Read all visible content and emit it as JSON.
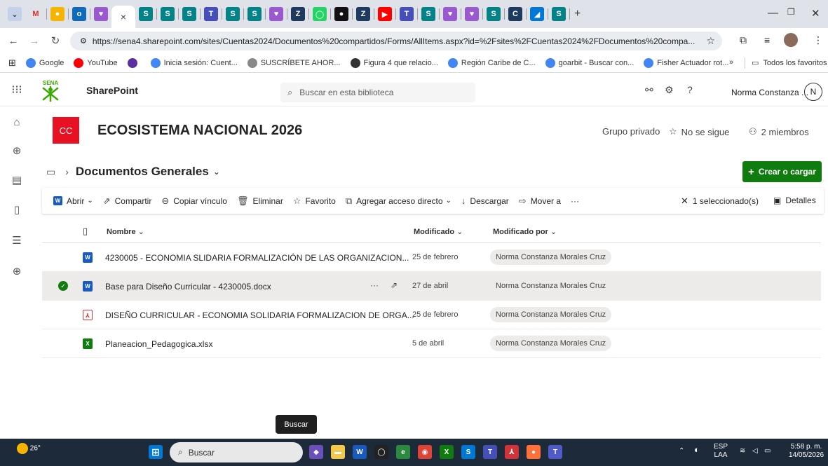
{
  "browser": {
    "url": "https://sena4.sharepoint.com/sites/Cuentas2024/Documentos%20compartidos/Forms/AllItems.aspx?id=%2Fsites%2FCuentas2024%2FDocumentos%20compa...",
    "active_tab_close": "×",
    "new_tab": "+",
    "bookmarks": [
      {
        "label": "Google",
        "color": "#4285f4"
      },
      {
        "label": "YouTube",
        "color": "#ff0000"
      },
      {
        "label": "",
        "color": "#5b2fa0"
      },
      {
        "label": "Inicia sesión: Cuent...",
        "color": "#4285f4"
      },
      {
        "label": "SUSCRÍBETE AHOR...",
        "color": "#888888"
      },
      {
        "label": "Figura 4 que relacio...",
        "color": "#333333"
      },
      {
        "label": "Región Caribe de C...",
        "color": "#4285f4"
      },
      {
        "label": "goarbit - Buscar con...",
        "color": "#4285f4"
      },
      {
        "label": "Fisher Actuador rot...",
        "color": "#4285f4"
      }
    ],
    "bookmarks_more": "»",
    "all_bookmarks": "Todos los favoritos"
  },
  "header": {
    "app_name": "SharePoint",
    "search_placeholder": "Buscar en esta biblioteca",
    "user_name": "Norma Constanza ...",
    "user_initial": "N"
  },
  "site": {
    "logo_initials": "CC",
    "title": "ECOSISTEMA NACIONAL 2026",
    "privacy": "Grupo privado",
    "follow": "No se sigue",
    "members": "2 miembros"
  },
  "library": {
    "name": "Documentos Generales",
    "create_label": "Crear o cargar"
  },
  "commands": {
    "open": "Abrir",
    "share": "Compartir",
    "copy_link": "Copiar vínculo",
    "delete": "Eliminar",
    "favorite": "Favorito",
    "shortcut": "Agregar acceso directo",
    "download": "Descargar",
    "move": "Mover a",
    "more": "···",
    "selected": "1 seleccionado(s)",
    "details": "Detalles"
  },
  "columns": {
    "name": "Nombre",
    "modified": "Modificado",
    "modified_by": "Modificado por"
  },
  "files": [
    {
      "name": "4230005 - ECONOMIA SLIDARIA FORMALIZACIÓN DE LAS ORGANIZACION...",
      "type": "word",
      "modified": "25 de febrero",
      "modified_by": "Norma Constanza Morales Cruz",
      "selected": false
    },
    {
      "name": "Base para Diseño Curricular - 4230005.docx",
      "type": "word",
      "modified": "27 de abril",
      "modified_by": "Norma Constanza Morales Cruz",
      "selected": true
    },
    {
      "name": "DISEÑO CURRICULAR - ECONOMIA SOLIDARIA FORMALIZACION DE ORGA...",
      "type": "pdf",
      "modified": "25 de febrero",
      "modified_by": "Norma Constanza Morales Cruz",
      "selected": false
    },
    {
      "name": "Planeacion_Pedagogica.xlsx",
      "type": "excel",
      "modified": "5 de abril",
      "modified_by": "Norma Constanza Morales Cruz",
      "selected": false
    }
  ],
  "tooltip": "Buscar",
  "taskbar": {
    "weather_temp": "26°",
    "search_placeholder": "Buscar",
    "lang_top": "ESP",
    "lang_bottom": "LAA",
    "time": "5:58 p. m.",
    "date": "14/05/2026"
  }
}
